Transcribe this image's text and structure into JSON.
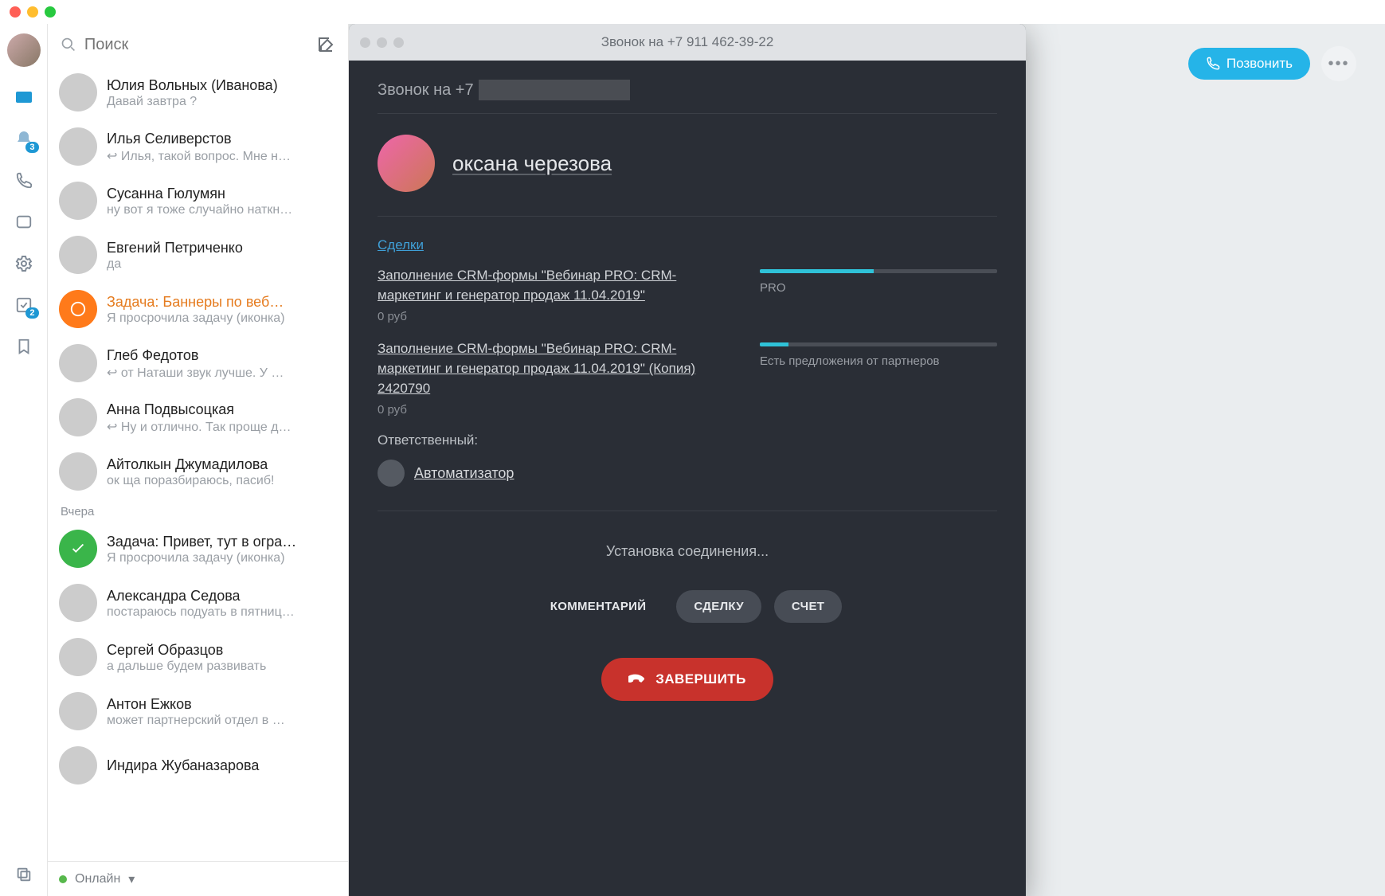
{
  "search": {
    "placeholder": "Поиск"
  },
  "nav": {
    "notif_badge": "3",
    "tasks_badge": "2"
  },
  "status": {
    "text": "Онлайн"
  },
  "sections": {
    "yesterday": "Вчера"
  },
  "chats": [
    {
      "name": "Юлия Вольных (Иванова)",
      "preview": "Давай завтра ?",
      "task": false,
      "icon": null
    },
    {
      "name": "Илья Селиверстов",
      "preview": "↩ Илья, такой вопрос. Мне н…",
      "task": false,
      "icon": null
    },
    {
      "name": "Сусанна Гюлумян",
      "preview": "ну вот я тоже случайно наткн…",
      "task": false,
      "icon": null
    },
    {
      "name": "Евгений Петриченко",
      "preview": "да",
      "task": false,
      "icon": null
    },
    {
      "name": "Задача: Баннеры по веб…",
      "preview": "Я просрочила задачу (иконка)",
      "task": true,
      "icon": "orange"
    },
    {
      "name": "Глеб Федотов",
      "preview": "↩ от Наташи звук лучше. У …",
      "task": false,
      "icon": null
    },
    {
      "name": "Анна Подвысоцкая",
      "preview": "↩ Ну и отлично. Так проще д…",
      "task": false,
      "icon": null
    },
    {
      "name": "Айтолкын Джумадилова",
      "preview": "ок ща поразбираюсь, пасиб!",
      "task": false,
      "icon": null
    }
  ],
  "chats_y": [
    {
      "name": "Задача: Привет, тут в огра…",
      "preview": "Я просрочила задачу (иконка)",
      "task": true,
      "icon": "green"
    },
    {
      "name": "Александра Седова",
      "preview": "постараюсь подуать в пятниц…",
      "task": false,
      "icon": null
    },
    {
      "name": "Сергей Образцов",
      "preview": "а дальше будем развивать",
      "task": false,
      "icon": null
    },
    {
      "name": "Антон Ежков",
      "preview": "может партнерский отдел в …",
      "task": false,
      "icon": null
    },
    {
      "name": "Индира Жубаназарова",
      "preview": "",
      "task": false,
      "icon": null
    }
  ],
  "topbar": {
    "call_label": "Позвонить"
  },
  "callwin": {
    "title": "Звонок на +7 911 462-39-22",
    "header_prefix": "Звонок на +7",
    "contact_name": "оксана черезова",
    "deals_title": "Сделки",
    "deals": [
      {
        "title": "Заполнение CRM-формы \"Вебинар PRO: CRM-маркетинг и генератор продаж 11.04.2019\"",
        "amount": "0 руб",
        "stage": "PRO",
        "progress": 48
      },
      {
        "title": "Заполнение CRM-формы \"Вебинар PRO: CRM-маркетинг и генератор продаж 11.04.2019\" (Копия) 2420790",
        "amount": "0 руб",
        "stage": "Есть предложения от партнеров",
        "progress": 12
      }
    ],
    "responsible_label": "Ответственный:",
    "responsible_name": "Автоматизатор",
    "connecting": "Установка соединения...",
    "actions": {
      "comment": "КОММЕНТАРИЙ",
      "deal": "СДЕЛКУ",
      "invoice": "СЧЕТ"
    },
    "hangup": "ЗАВЕРШИТЬ"
  }
}
